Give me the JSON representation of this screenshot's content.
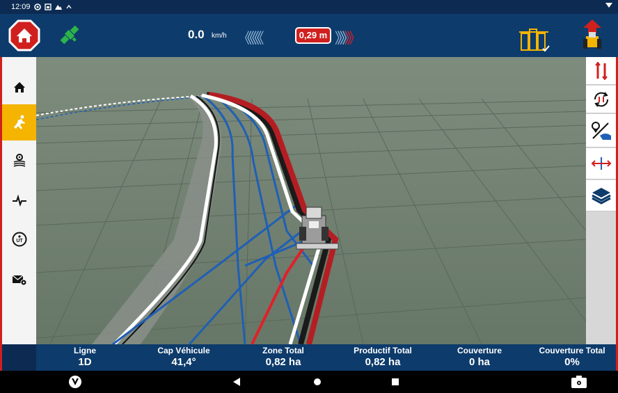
{
  "status_bar": {
    "time": "12:09"
  },
  "header": {
    "speed_value": "0.0",
    "speed_unit": "km/h",
    "offset": "0,29 m",
    "chevrons_left": "《《《《《《",
    "chevrons_right_white": "》》》》",
    "chevrons_right_red": "》》"
  },
  "sidebar_left": [
    "home",
    "guidance",
    "settings",
    "diagnostics",
    "isobus-ut",
    "messages"
  ],
  "sidebar_right": [
    "switch-line",
    "cycle-line",
    "point-marker",
    "offset-line",
    "layers"
  ],
  "stats": [
    {
      "label": "Ligne",
      "value": "1D"
    },
    {
      "label": "Cap Véhicule",
      "value": "41,4°"
    },
    {
      "label": "Zone Total",
      "value": "0,82 ha"
    },
    {
      "label": "Productif Total",
      "value": "0,82 ha"
    },
    {
      "label": "Couverture",
      "value": "0 ha"
    },
    {
      "label": "Couverture Total",
      "value": "0%"
    }
  ],
  "colors": {
    "header_bg": "#0d3b6b",
    "accent_red": "#d0201e",
    "active_yellow": "#f4b400",
    "guidance_blue": "#1f5fb5",
    "field_green": "#6f7f6f"
  }
}
